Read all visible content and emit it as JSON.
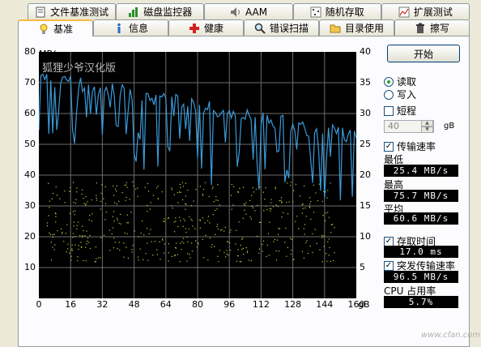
{
  "tabs_back": [
    {
      "label": "文件基准测试",
      "icon": "file-icon"
    },
    {
      "label": "磁盘监控器",
      "icon": "monitor-icon"
    },
    {
      "label": "AAM",
      "icon": "speaker-icon"
    },
    {
      "label": "随机存取",
      "icon": "random-icon"
    },
    {
      "label": "扩展测试",
      "icon": "extra-icon"
    }
  ],
  "tabs_front": [
    {
      "label": "基准",
      "icon": "bulb-icon",
      "active": true
    },
    {
      "label": "信息",
      "icon": "info-icon"
    },
    {
      "label": "健康",
      "icon": "health-cross-icon"
    },
    {
      "label": "错误扫描",
      "icon": "magnifier-icon"
    },
    {
      "label": "目录使用",
      "icon": "folder-icon"
    },
    {
      "label": "擦写",
      "icon": "trash-icon"
    }
  ],
  "chart_data": {
    "type": "line",
    "watermark": "狐狸少爷汉化版",
    "y_left_unit": "MB/s",
    "y_right_unit": "ms",
    "x_unit": "gB",
    "y_left_ticks": [
      "80",
      "70",
      "60",
      "50",
      "40",
      "30",
      "20",
      "10"
    ],
    "y_right_ticks": [
      "40",
      "35",
      "30",
      "25",
      "20",
      "15",
      "10",
      "5"
    ],
    "x_ticks": [
      "0",
      "16",
      "32",
      "48",
      "64",
      "80",
      "96",
      "112",
      "128",
      "144",
      "160"
    ],
    "ylim": [
      0,
      80
    ],
    "y2lim": [
      0,
      40
    ],
    "xlim": [
      0,
      160
    ],
    "grid": true,
    "series": [
      {
        "color": "#3a9ad9",
        "x": [
          0,
          4,
          8,
          12,
          16,
          20,
          24,
          28,
          32,
          36,
          40,
          44,
          48,
          52,
          56,
          60,
          64,
          68,
          72,
          76,
          80,
          84,
          88,
          92,
          96,
          100,
          104,
          108,
          112,
          116,
          120,
          124,
          128,
          132,
          136,
          140,
          144,
          148,
          152,
          156,
          160
        ],
        "values": [
          73,
          72,
          71,
          71,
          70,
          70,
          69,
          69,
          68,
          68,
          67,
          67,
          66,
          66,
          65,
          65,
          64,
          64,
          63,
          63,
          62,
          62,
          61,
          61,
          60,
          60,
          59,
          59,
          58,
          58,
          57,
          57,
          56,
          56,
          55,
          55,
          54,
          54,
          53,
          53,
          52
        ]
      }
    ],
    "access_time_scatter": {
      "color": "#c8d040",
      "x_range": [
        4,
        150
      ],
      "ms_range": [
        6,
        19
      ]
    }
  },
  "sidebar": {
    "start_label": "开始",
    "read_label": "读取",
    "write_label": "写入",
    "short_label": "短程",
    "short_value": "40",
    "short_unit": "gB",
    "transfer_label": "传输速率",
    "min_label": "最低",
    "min_value": "25.4 MB/s",
    "max_label": "最高",
    "max_value": "75.7 MB/s",
    "avg_label": "平均",
    "avg_value": "60.6 MB/s",
    "access_label": "存取时间",
    "access_value": "17.0 ms",
    "burst_label": "突发传输速率",
    "burst_value": "96.5 MB/s",
    "cpu_label": "CPU 占用率",
    "cpu_value": "5.7%"
  },
  "footer": "www.cfan.com.cn"
}
